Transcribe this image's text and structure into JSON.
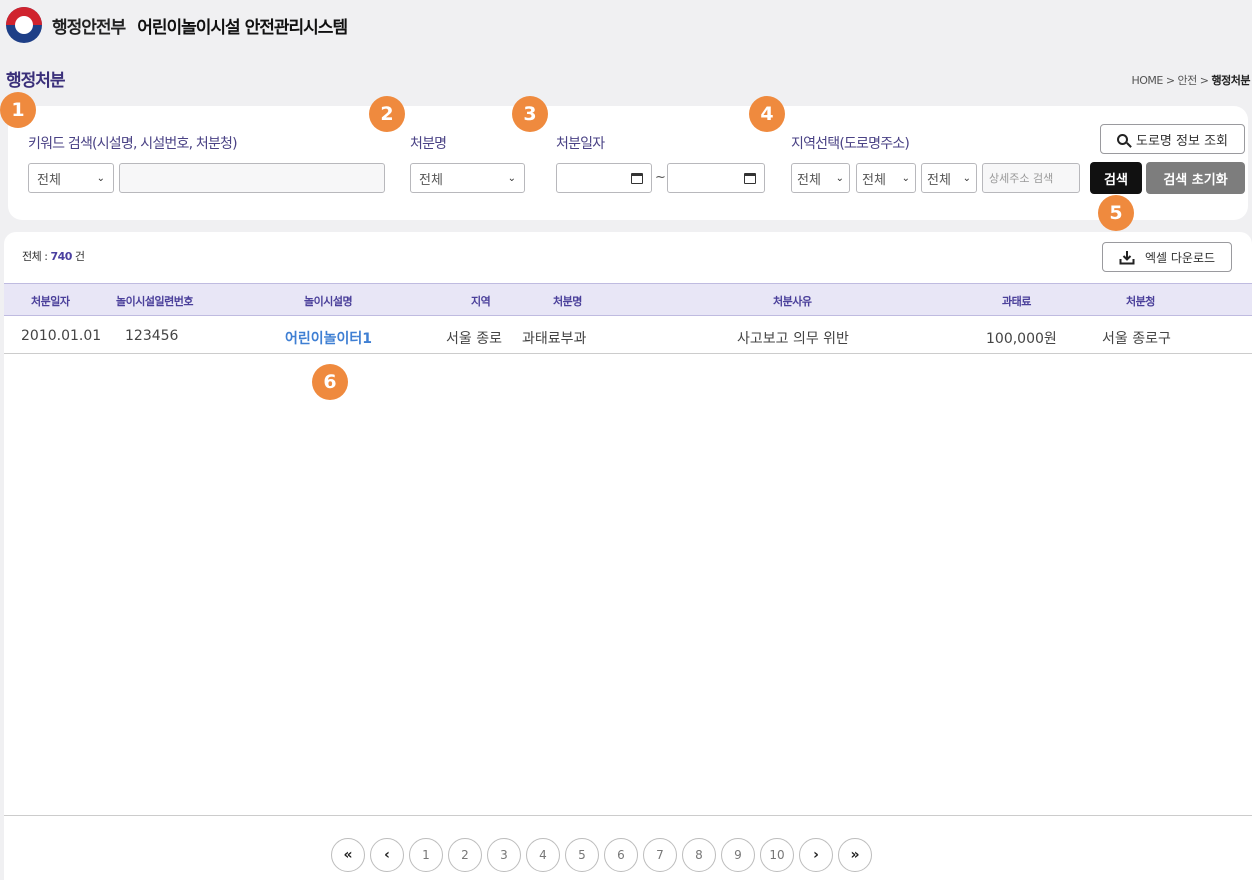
{
  "header": {
    "ministry": "행정안전부",
    "system_name": "어린이놀이시설 안전관리시스템"
  },
  "page": {
    "title": "행정처분",
    "breadcrumb_home": "HOME",
    "breadcrumb_mid": "안전",
    "breadcrumb_current": "행정처분",
    "breadcrumb_sep": ">"
  },
  "search": {
    "keyword_label": "키워드 검색(시설명, 시설번호, 처분청)",
    "keyword_select": "전체",
    "keyword_input": "",
    "disposition_label": "처분명",
    "disposition_select": "전체",
    "date_label": "처분일자",
    "date_sep": "~",
    "region_label": "지역선택(도로명주소)",
    "region1": "전체",
    "region2": "전체",
    "region3": "전체",
    "detail_address_placeholder": "상세주소 검색",
    "road_info_button": "도로명 정보 조회",
    "search_button": "검색",
    "reset_button": "검색 초기화"
  },
  "results": {
    "total_label": "전체 :",
    "total_count": "740",
    "total_unit": "건",
    "excel_button": "엑셀 다운로드",
    "columns": [
      "처분일자",
      "놀이시설일련번호",
      "놀이시설명",
      "지역",
      "처분명",
      "처분사유",
      "과태료",
      "처분청"
    ],
    "rows": [
      {
        "date": "2010.01.01",
        "serial": "123456",
        "facility": "어린이놀이터1",
        "region": "서울 종로",
        "disposition": "과태료부과",
        "reason": "사고보고 의무 위반",
        "fine": "100,000원",
        "authority": "서울 종로구"
      }
    ]
  },
  "pagination": {
    "first": "«",
    "prev": "‹",
    "pages": [
      "1",
      "2",
      "3",
      "4",
      "5",
      "6",
      "7",
      "8",
      "9",
      "10"
    ],
    "next": "›",
    "last": "»"
  },
  "badges": [
    "1",
    "2",
    "3",
    "4",
    "5",
    "6"
  ],
  "colors": {
    "accent": "#4a3fa0",
    "badge": "#ef8a3e",
    "link": "#3f7fd3"
  }
}
